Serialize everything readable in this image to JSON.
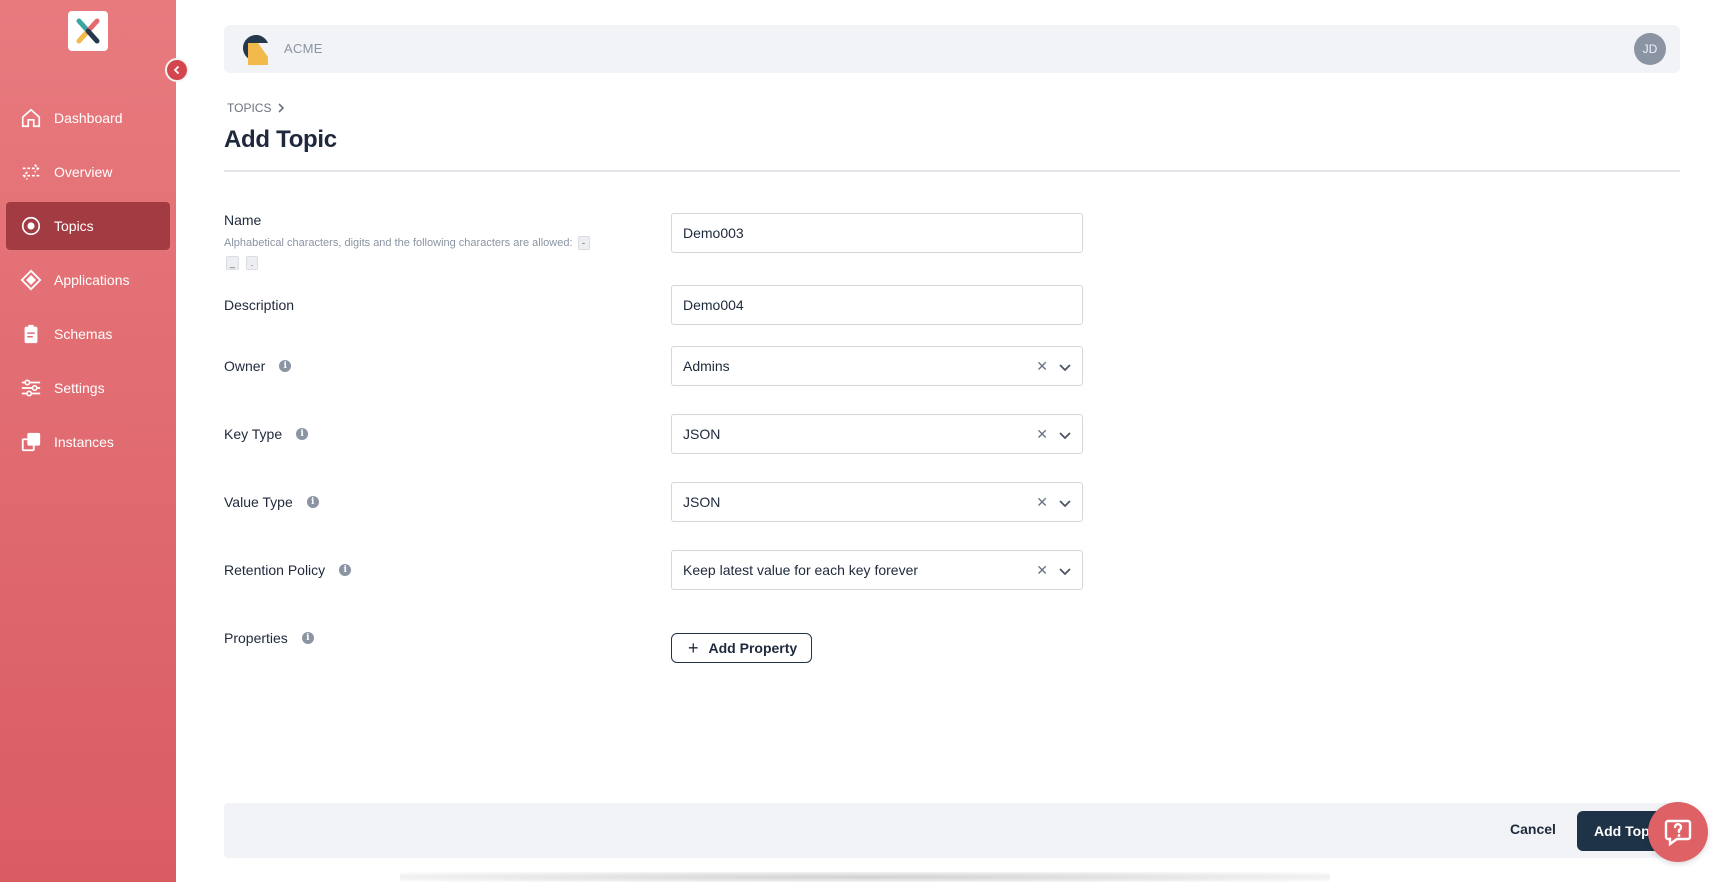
{
  "sidebar": {
    "items": [
      {
        "label": "Dashboard",
        "icon": "home-icon"
      },
      {
        "label": "Overview",
        "icon": "arrows-icon"
      },
      {
        "label": "Topics",
        "icon": "target-icon",
        "active": true
      },
      {
        "label": "Applications",
        "icon": "diamond-icon"
      },
      {
        "label": "Schemas",
        "icon": "clipboard-icon"
      },
      {
        "label": "Settings",
        "icon": "sliders-icon"
      },
      {
        "label": "Instances",
        "icon": "instances-icon"
      }
    ]
  },
  "header": {
    "org_name": "ACME",
    "avatar_initials": "JD"
  },
  "breadcrumb": {
    "item": "TOPICS"
  },
  "page": {
    "title": "Add Topic"
  },
  "form": {
    "name": {
      "label": "Name",
      "hint": "Alphabetical characters, digits and the following characters are allowed:",
      "allowed_chars": [
        "-",
        "_",
        "."
      ],
      "value": "Demo003"
    },
    "description": {
      "label": "Description",
      "value": "Demo004"
    },
    "owner": {
      "label": "Owner",
      "value": "Admins"
    },
    "key_type": {
      "label": "Key Type",
      "value": "JSON"
    },
    "value_type": {
      "label": "Value Type",
      "value": "JSON"
    },
    "retention_policy": {
      "label": "Retention Policy",
      "value": "Keep latest value for each key forever"
    },
    "properties": {
      "label": "Properties",
      "add_label": "Add Property"
    }
  },
  "footer": {
    "cancel_label": "Cancel",
    "submit_label": "Add Topic"
  },
  "colors": {
    "sidebar_top": "#e87a7e",
    "sidebar_bottom": "#d95c62",
    "active_item": "#a33c42",
    "primary": "#1e3347",
    "help_button": "#de6166"
  }
}
